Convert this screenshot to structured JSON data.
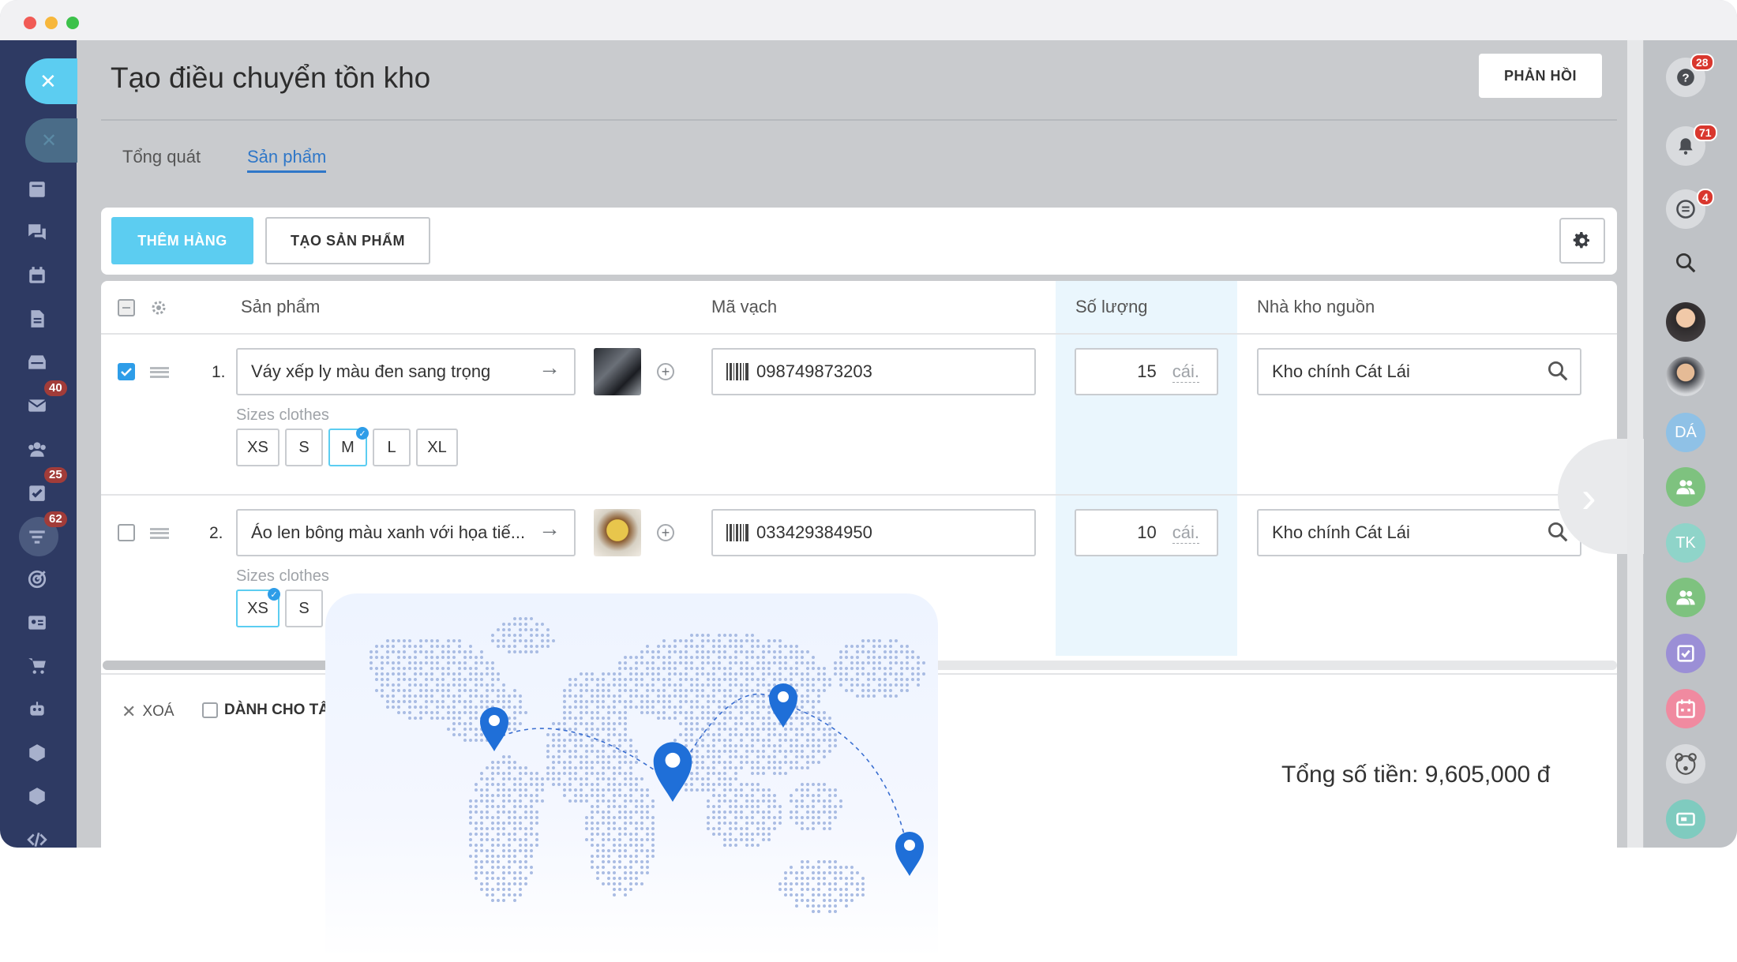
{
  "window": {
    "dots": [
      "#f15b55",
      "#f7b73b",
      "#3cc14a"
    ]
  },
  "left_nav": {
    "items": [
      {
        "icon": "list-icon"
      },
      {
        "icon": "chat-icon"
      },
      {
        "icon": "calendar-icon"
      },
      {
        "icon": "document-icon"
      },
      {
        "icon": "inbox-icon"
      },
      {
        "icon": "mail-icon",
        "badge": "40"
      },
      {
        "icon": "team-icon"
      },
      {
        "icon": "task-icon",
        "badge": "25"
      },
      {
        "icon": "filter-icon",
        "badge": "62"
      },
      {
        "icon": "target-icon"
      },
      {
        "icon": "contact-card-icon"
      },
      {
        "icon": "cart-icon"
      },
      {
        "icon": "robot-icon"
      },
      {
        "icon": "box-icon"
      },
      {
        "icon": "box-icon"
      },
      {
        "icon": "code-icon"
      }
    ]
  },
  "header": {
    "title": "Tạo điều chuyển tồn kho",
    "feedback_label": "PHẢN HỒI"
  },
  "tabs": [
    {
      "label": "Tổng quát",
      "active": false
    },
    {
      "label": "Sản phẩm",
      "active": true
    }
  ],
  "toolbar": {
    "add_label": "THÊM HÀNG",
    "create_label": "TẠO SẢN PHẨM"
  },
  "table": {
    "columns": {
      "product": "Sản phẩm",
      "barcode": "Mã vạch",
      "quantity": "Số lượng",
      "warehouse": "Nhà kho nguồn"
    },
    "rows": [
      {
        "number": "1.",
        "checked": true,
        "product": "Váy xếp ly màu đen sang trọng",
        "barcode": "098749873203",
        "quantity": "15",
        "unit": "cái.",
        "warehouse": "Kho chính Cát Lái",
        "sizes_label": "Sizes clothes",
        "sizes": [
          "XS",
          "S",
          "M",
          "L",
          "XL"
        ],
        "selected_size": "M"
      },
      {
        "number": "2.",
        "checked": false,
        "product": "Áo len bông màu xanh với họa tiế...",
        "barcode": "033429384950",
        "quantity": "10",
        "unit": "cái.",
        "warehouse": "Kho chính Cát Lái",
        "sizes_label": "Sizes clothes",
        "sizes": [
          "XS",
          "S"
        ],
        "selected_size": "XS"
      }
    ]
  },
  "footer": {
    "delete_label": "XOÁ",
    "for_all_label": "DÀNH CHO TẤ",
    "total": "Tổng số tiền: 9,605,000 đ"
  },
  "right_bar": {
    "items": [
      {
        "icon": "help-icon",
        "badge": "28"
      },
      {
        "icon": "bell-icon",
        "badge": "71"
      },
      {
        "icon": "chat-bubble-icon",
        "badge": "4"
      },
      {
        "icon": "search-icon"
      },
      {
        "icon": "avatar-woman"
      },
      {
        "icon": "avatar-man"
      },
      {
        "initials": "DÁ",
        "color": "#8fc1e6"
      },
      {
        "icon": "group-icon",
        "color": "#7ec27f"
      },
      {
        "initials": "TK",
        "color": "#8fd4c9"
      },
      {
        "icon": "group-icon",
        "color": "#7ec27f"
      },
      {
        "icon": "checklist-icon",
        "color": "#9b8fd6"
      },
      {
        "icon": "calendar-icon",
        "color": "#f08aa0"
      },
      {
        "icon": "bear-icon"
      },
      {
        "icon": "ticket-icon",
        "color": "#7fcbbf"
      }
    ]
  },
  "colors": {
    "accent": "#5ccdf1",
    "sidebar": "#2e3a63",
    "badge": "#d9372e",
    "map_pin": "#1f6fd8"
  }
}
